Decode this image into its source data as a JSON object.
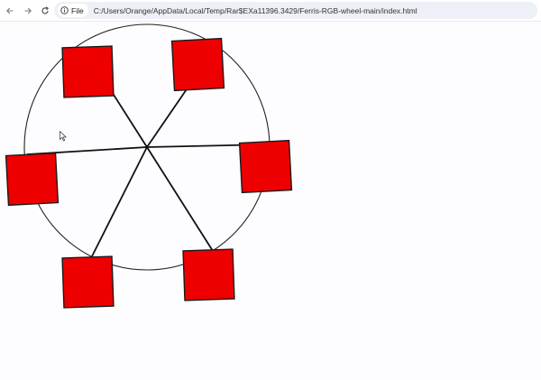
{
  "browser": {
    "toolbar": {
      "back_icon": "arrow-left-icon",
      "forward_icon": "arrow-right-icon",
      "reload_icon": "reload-icon"
    },
    "address_bar": {
      "scheme_chip": "File",
      "scheme_icon": "info-circle-icon",
      "url": "C:/Users/Orange/AppData/Local/Temp/Rar$EXa11396.3429/Ferris-RGB-wheel-main/index.html"
    }
  },
  "scene": {
    "wheel_stroke_color": "#222222",
    "spoke_color": "#111111",
    "cabin_fill_color": "#ee0000",
    "cabin_stroke_color": "#1a1a1a",
    "cabin_count": 6,
    "spoke_count": 6
  }
}
